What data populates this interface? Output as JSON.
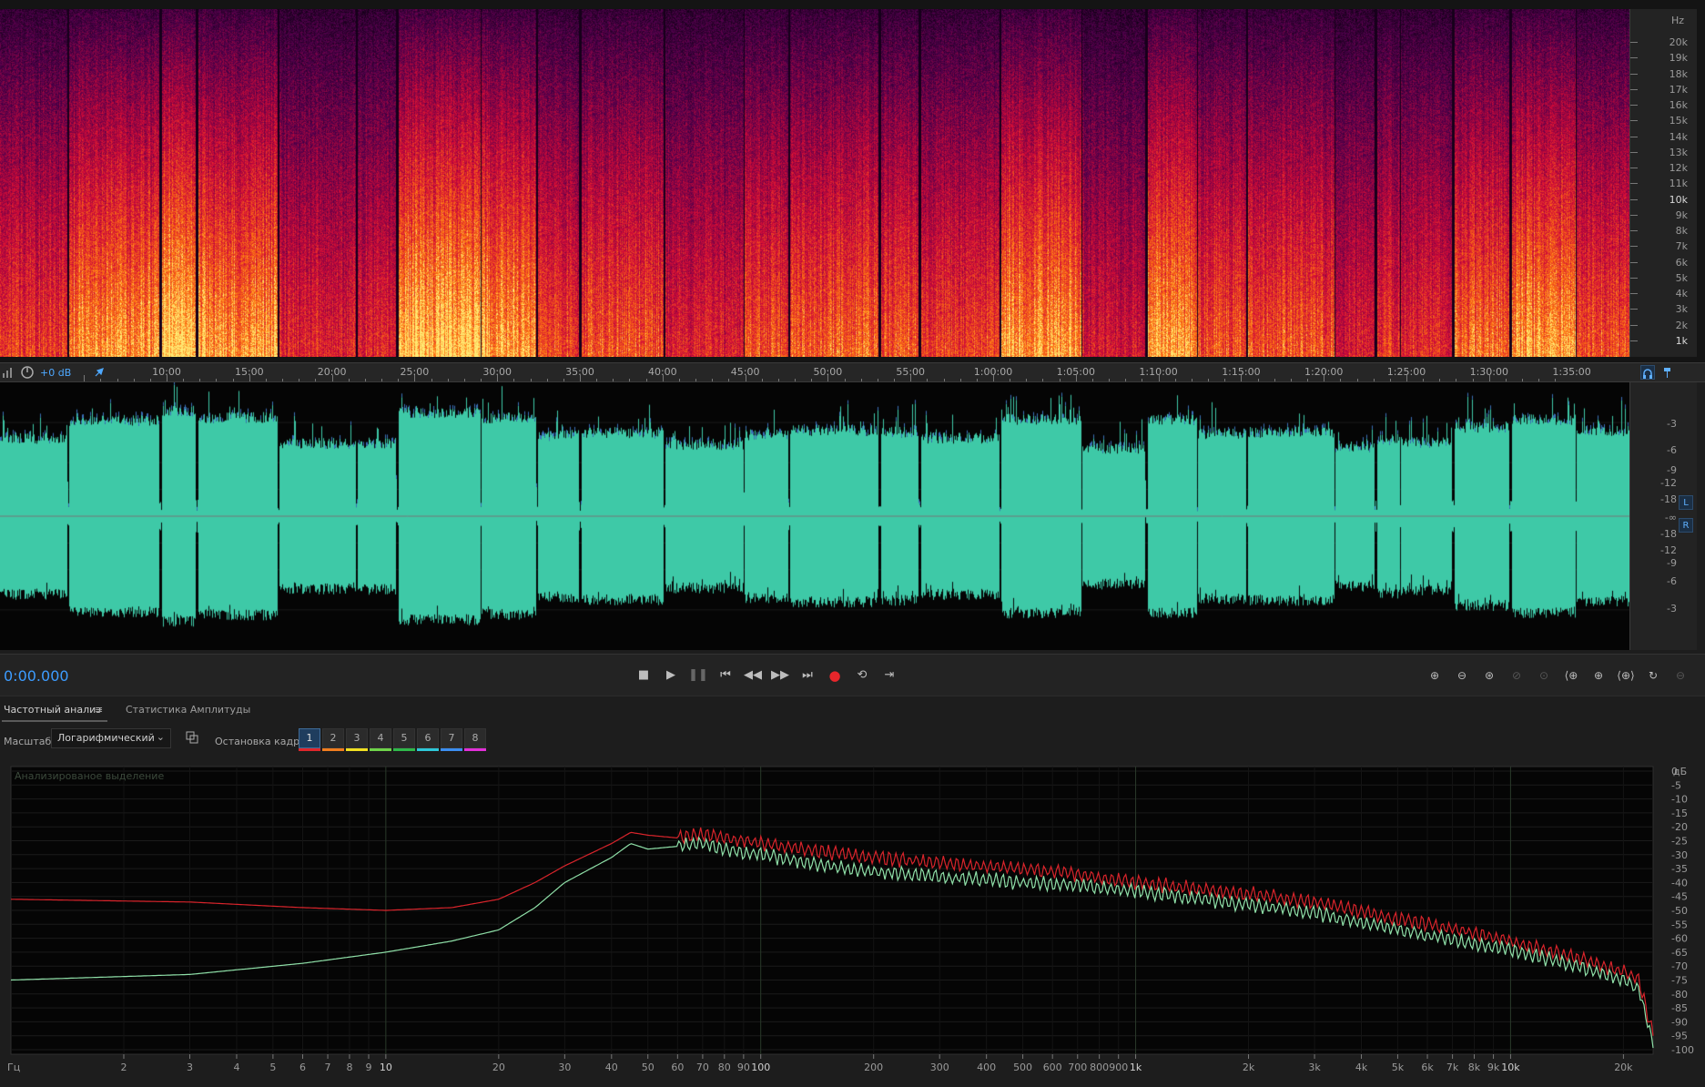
{
  "spectrogram": {
    "unit_label": "Hz",
    "freq_labels": [
      "20k",
      "19k",
      "18k",
      "17k",
      "16k",
      "15k",
      "14k",
      "13k",
      "12k",
      "11k",
      "10k",
      "9k",
      "8k",
      "7k",
      "6k",
      "5k",
      "4k",
      "3k",
      "2k",
      "1k"
    ],
    "colors": {
      "low": "#0a0010",
      "mid": "#c0173a",
      "high": "#ffe36b"
    }
  },
  "timeline": {
    "gain_label": "+0 dB",
    "labels": [
      "10:00",
      "15:00",
      "20:00",
      "25:00",
      "30:00",
      "35:00",
      "40:00",
      "45:00",
      "50:00",
      "55:00",
      "1:00:00",
      "1:05:00",
      "1:10:00",
      "1:15:00",
      "1:20:00",
      "1:25:00",
      "1:30:00",
      "1:35:00"
    ]
  },
  "waveform": {
    "color": "#3ec9a7",
    "db_labels_top": [
      "-3",
      "-6",
      "-9",
      "-12",
      "-18",
      "-∞"
    ],
    "db_labels_bottom": [
      "-18",
      "-12",
      "-9",
      "-6",
      "-3"
    ],
    "channels": [
      "L",
      "R"
    ]
  },
  "transport": {
    "timecode": "0:00.000",
    "buttons": [
      "stop-icon",
      "play-icon",
      "pause-icon",
      "skip-start-icon",
      "rewind-icon",
      "fast-forward-icon",
      "skip-end-icon",
      "record-icon",
      "loop-icon",
      "skip-selection-icon"
    ],
    "record_color": "#e8262b"
  },
  "panel": {
    "tabs": [
      {
        "label": "Частотный анализ",
        "active": true
      },
      {
        "label": "Статистика Амплитуды",
        "active": false
      }
    ],
    "scale_label": "Масштаб:",
    "scale_value": "Логарифмический",
    "freeze_label": "Остановка кадра:",
    "frames": [
      {
        "label": "1",
        "color": "#e0262b"
      },
      {
        "label": "2",
        "color": "#f07d1f"
      },
      {
        "label": "3",
        "color": "#f0e022"
      },
      {
        "label": "4",
        "color": "#6fd44a"
      },
      {
        "label": "5",
        "color": "#2fb84a"
      },
      {
        "label": "6",
        "color": "#2ec7d8"
      },
      {
        "label": "7",
        "color": "#3c8ef0"
      },
      {
        "label": "8",
        "color": "#e22fd8"
      }
    ]
  },
  "spectrum": {
    "overlay_label": "Анализированое выделение",
    "x_unit": "Гц",
    "y_unit": "дБ",
    "x_ticks": [
      {
        "f": 2,
        "label": "2"
      },
      {
        "f": 3,
        "label": "3"
      },
      {
        "f": 4,
        "label": "4"
      },
      {
        "f": 5,
        "label": "5"
      },
      {
        "f": 6,
        "label": "6"
      },
      {
        "f": 7,
        "label": "7"
      },
      {
        "f": 8,
        "label": "8"
      },
      {
        "f": 9,
        "label": "9"
      },
      {
        "f": 10,
        "label": "10",
        "bold": true
      },
      {
        "f": 20,
        "label": "20"
      },
      {
        "f": 30,
        "label": "30"
      },
      {
        "f": 40,
        "label": "40"
      },
      {
        "f": 50,
        "label": "50"
      },
      {
        "f": 60,
        "label": "60"
      },
      {
        "f": 70,
        "label": "70"
      },
      {
        "f": 80,
        "label": "80"
      },
      {
        "f": 90,
        "label": "90"
      },
      {
        "f": 100,
        "label": "100",
        "bold": true
      },
      {
        "f": 200,
        "label": "200"
      },
      {
        "f": 300,
        "label": "300"
      },
      {
        "f": 400,
        "label": "400"
      },
      {
        "f": 500,
        "label": "500"
      },
      {
        "f": 600,
        "label": "600"
      },
      {
        "f": 700,
        "label": "700"
      },
      {
        "f": 800,
        "label": "800"
      },
      {
        "f": 900,
        "label": "900"
      },
      {
        "f": 1000,
        "label": "1k",
        "bold": true
      },
      {
        "f": 2000,
        "label": "2k"
      },
      {
        "f": 3000,
        "label": "3k"
      },
      {
        "f": 4000,
        "label": "4k"
      },
      {
        "f": 5000,
        "label": "5k"
      },
      {
        "f": 6000,
        "label": "6k"
      },
      {
        "f": 7000,
        "label": "7k"
      },
      {
        "f": 8000,
        "label": "8k"
      },
      {
        "f": 9000,
        "label": "9k"
      },
      {
        "f": 10000,
        "label": "10k",
        "bold": true
      },
      {
        "f": 20000,
        "label": "20k"
      }
    ],
    "y_ticks": [
      "0",
      "-5",
      "-10",
      "-15",
      "-20",
      "-25",
      "-30",
      "-35",
      "-40",
      "-45",
      "-50",
      "-55",
      "-60",
      "-65",
      "-70",
      "-75",
      "-80",
      "-85",
      "-90",
      "-95",
      "-100"
    ],
    "series": [
      {
        "color": "#d8242b",
        "points": [
          [
            1,
            -46
          ],
          [
            3,
            -47
          ],
          [
            6,
            -49
          ],
          [
            10,
            -50
          ],
          [
            15,
            -49
          ],
          [
            20,
            -46
          ],
          [
            25,
            -40
          ],
          [
            30,
            -34
          ],
          [
            40,
            -26
          ],
          [
            45,
            -22
          ],
          [
            50,
            -23
          ],
          [
            60,
            -24
          ],
          [
            70,
            -22.5
          ],
          [
            80,
            -24
          ],
          [
            100,
            -26
          ],
          [
            150,
            -29
          ],
          [
            200,
            -31
          ],
          [
            300,
            -33
          ],
          [
            500,
            -35
          ],
          [
            700,
            -37
          ],
          [
            1000,
            -40
          ],
          [
            2000,
            -44
          ],
          [
            3000,
            -47
          ],
          [
            5000,
            -53
          ],
          [
            8000,
            -58
          ],
          [
            10000,
            -61
          ],
          [
            15000,
            -67
          ],
          [
            20000,
            -72
          ],
          [
            22000,
            -75
          ],
          [
            24000,
            -95
          ]
        ]
      },
      {
        "color": "#8fe0a8",
        "points": [
          [
            1,
            -75
          ],
          [
            3,
            -73
          ],
          [
            6,
            -69
          ],
          [
            10,
            -65
          ],
          [
            15,
            -61
          ],
          [
            20,
            -57
          ],
          [
            25,
            -49
          ],
          [
            30,
            -40
          ],
          [
            40,
            -31
          ],
          [
            45,
            -26
          ],
          [
            50,
            -28
          ],
          [
            60,
            -27
          ],
          [
            70,
            -26
          ],
          [
            80,
            -28
          ],
          [
            100,
            -30
          ],
          [
            150,
            -34
          ],
          [
            200,
            -36
          ],
          [
            300,
            -38
          ],
          [
            500,
            -40
          ],
          [
            700,
            -41
          ],
          [
            1000,
            -43
          ],
          [
            2000,
            -48
          ],
          [
            3000,
            -51
          ],
          [
            5000,
            -57
          ],
          [
            8000,
            -62
          ],
          [
            10000,
            -64
          ],
          [
            15000,
            -70
          ],
          [
            20000,
            -75
          ],
          [
            22000,
            -78
          ],
          [
            24000,
            -98
          ]
        ]
      }
    ]
  }
}
